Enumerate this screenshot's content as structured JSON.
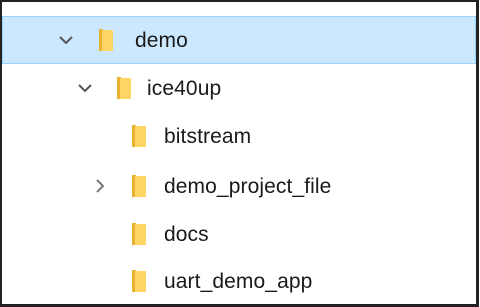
{
  "tree": {
    "items": [
      {
        "label": "demo",
        "expander": "chevron-down-icon",
        "icon": "folder-icon",
        "selected": true
      },
      {
        "label": "ice40up",
        "expander": "chevron-down-icon",
        "icon": "folder-icon",
        "selected": false
      },
      {
        "label": "bitstream",
        "expander": "",
        "icon": "folder-icon",
        "selected": false
      },
      {
        "label": "demo_project_file",
        "expander": "chevron-right-icon",
        "icon": "folder-icon",
        "selected": false
      },
      {
        "label": "docs",
        "expander": "",
        "icon": "folder-icon",
        "selected": false
      },
      {
        "label": "uart_demo_app",
        "expander": "",
        "icon": "folder-icon",
        "selected": false
      }
    ]
  },
  "colors": {
    "selection_bg": "#cce8ff",
    "selection_border": "#99d1ff",
    "folder_yellow": "#ffd565",
    "folder_dark": "#e8b230",
    "chevron": "#555555"
  }
}
